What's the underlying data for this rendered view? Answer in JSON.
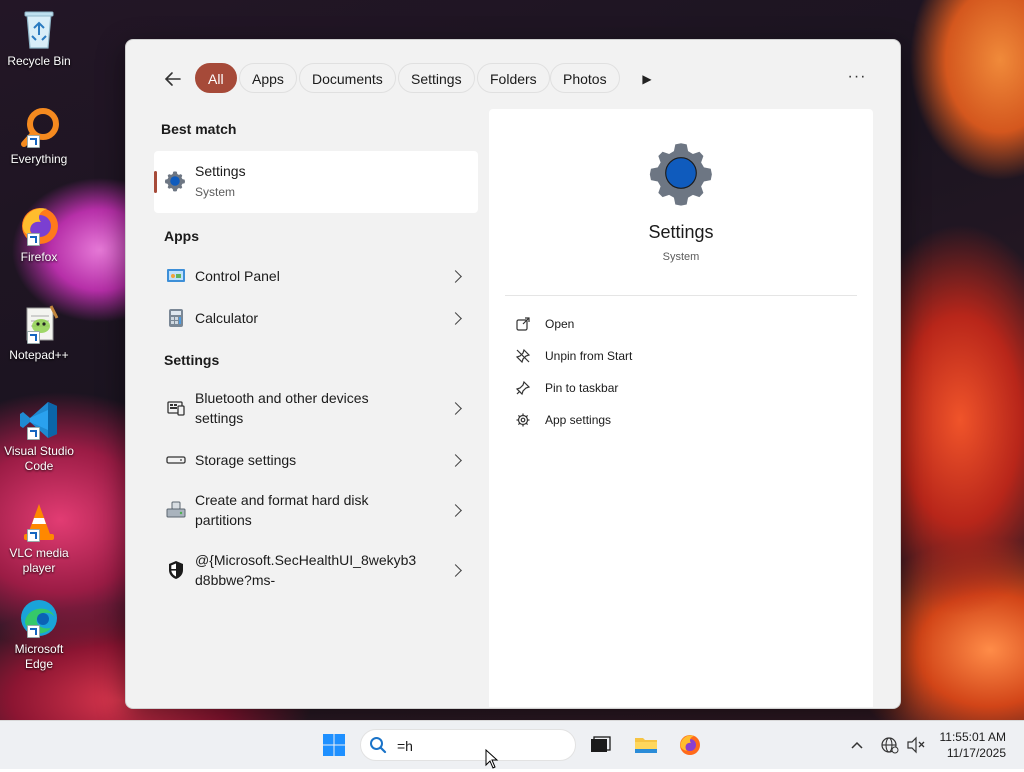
{
  "desktop": {
    "icons": [
      {
        "label": "Recycle Bin"
      },
      {
        "label": "Everything"
      },
      {
        "label": "Firefox"
      },
      {
        "label": "Notepad++"
      },
      {
        "label": "Visual Studio Code"
      },
      {
        "label": "VLC media player"
      },
      {
        "label": "Microsoft Edge"
      }
    ]
  },
  "search_flyout": {
    "filters": [
      "All",
      "Apps",
      "Documents",
      "Settings",
      "Folders",
      "Photos"
    ],
    "active_filter": "All",
    "best_match_label": "Best match",
    "best_match": {
      "title": "Settings",
      "subtitle": "System",
      "icon": "settings-gear-icon"
    },
    "apps_label": "Apps",
    "apps": [
      {
        "title": "Control Panel",
        "icon": "control-panel-icon"
      },
      {
        "title": "Calculator",
        "icon": "calculator-icon"
      }
    ],
    "settings_label": "Settings",
    "settings": [
      {
        "title_line1": "Bluetooth and other devices",
        "title_line2": "settings",
        "icon": "bluetooth-devices-icon"
      },
      {
        "title_line1": "Storage settings",
        "title_line2": "",
        "icon": "storage-icon"
      },
      {
        "title_line1": "Create and format hard disk",
        "title_line2": "partitions",
        "icon": "disk-management-icon"
      },
      {
        "title_line1": "@{Microsoft.SecHealthUI_8wekyb3",
        "title_line2": "d8bbwe?ms-",
        "icon": "shield-icon"
      }
    ],
    "preview": {
      "title": "Settings",
      "subtitle": "System",
      "actions": [
        {
          "label": "Open",
          "icon": "open-external-icon"
        },
        {
          "label": "Unpin from Start",
          "icon": "unpin-icon"
        },
        {
          "label": "Pin to taskbar",
          "icon": "pin-icon"
        },
        {
          "label": "App settings",
          "icon": "gear-icon"
        }
      ]
    }
  },
  "taskbar": {
    "search_value": "=h",
    "time": "11:55:01 AM",
    "date": "11/17/2025"
  },
  "colors": {
    "accent": "#a64a39",
    "settings_blue": "#0f5bbd"
  }
}
